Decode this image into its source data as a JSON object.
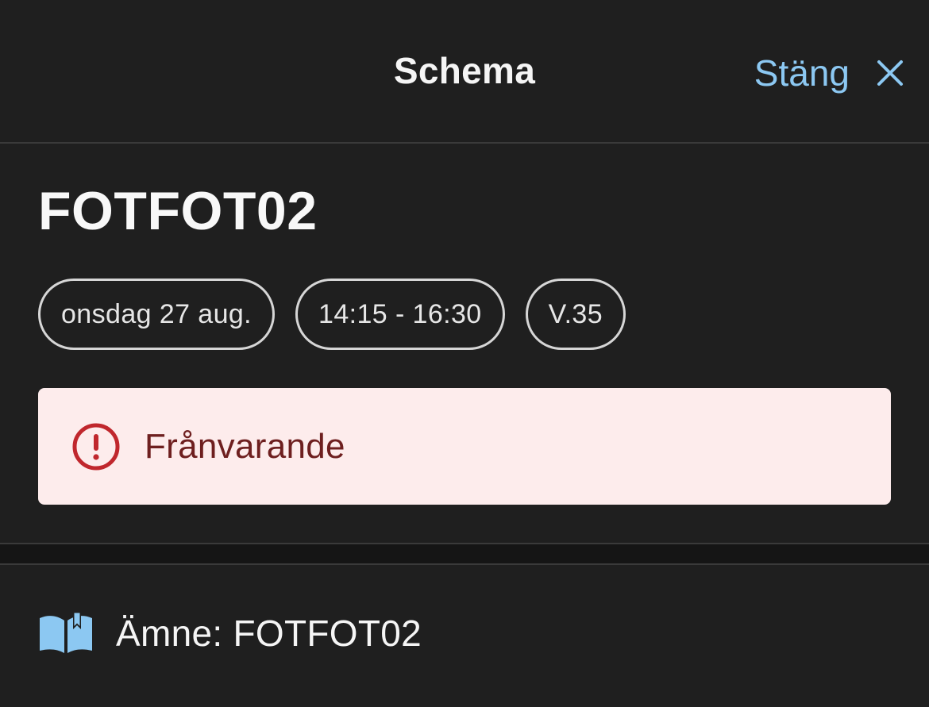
{
  "header": {
    "title": "Schema",
    "close_label": "Stäng",
    "close_icon": "close-icon"
  },
  "event": {
    "title": "FOTFOT02",
    "chips": {
      "date": "onsdag 27 aug.",
      "time": "14:15 - 16:30",
      "week": "V.35"
    },
    "alert": {
      "icon": "exclamation-circle-icon",
      "text": "Frånvarande"
    }
  },
  "subject": {
    "icon": "book-icon",
    "label": "Ämne: FOTFOT02"
  },
  "colors": {
    "background": "#1f1f1f",
    "accent": "#8cc8f2",
    "alert_background": "#fdecec",
    "alert_text": "#6e1f1f",
    "alert_icon": "#c0272d",
    "divider": "#3a3a3a"
  }
}
